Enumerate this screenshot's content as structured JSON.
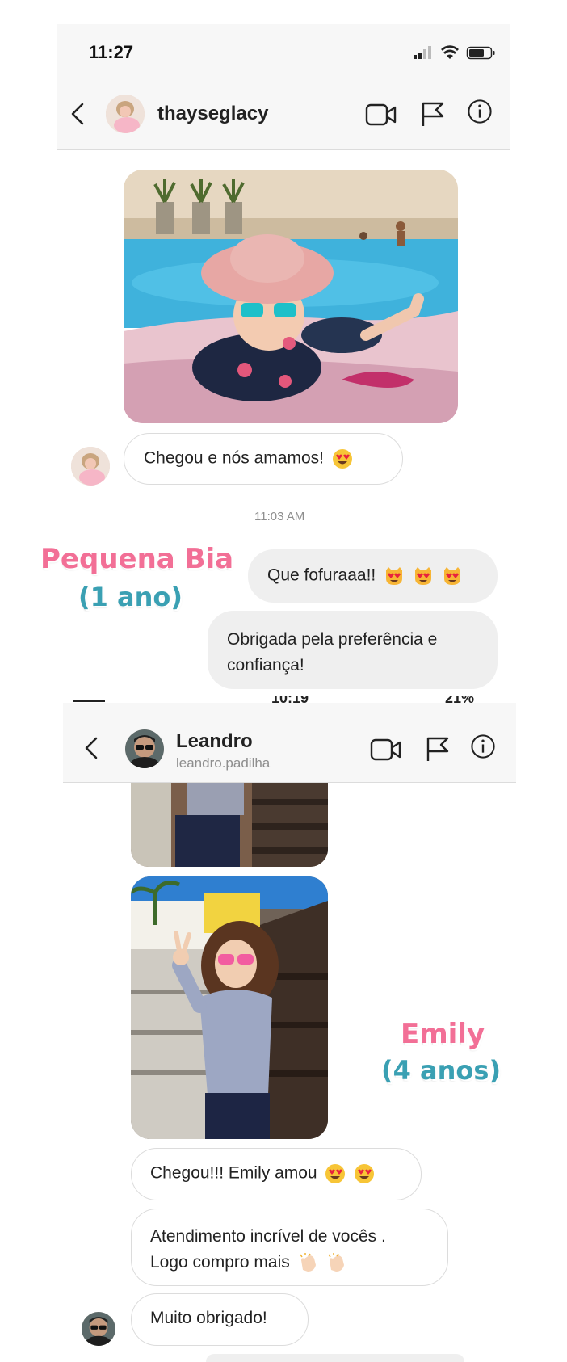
{
  "chat1": {
    "status_time": "11:27",
    "username": "thayseglacy",
    "message_1": "Chegou e nós amamos!",
    "timestamp": "11:03 AM",
    "reply_1": "Que fofuraaa!!",
    "reply_2_line1": "Obrigada pela preferência e",
    "reply_2_line2": "confiança!",
    "caption_name": "Pequena Bia",
    "caption_age": "(1 ano)"
  },
  "chat2": {
    "status_time": "10:19",
    "status_battery": "21%",
    "name": "Leandro",
    "handle": "leandro.padilha",
    "message_1": "Chegou!!! Emily amou",
    "message_2_line1": "Atendimento incrível de vocês .",
    "message_2_line2": "Logo compro mais",
    "message_3": "Muito obrigado!",
    "caption_name": "Emily",
    "caption_age": "(4 anos)"
  },
  "icons": {
    "back": "chevron-left-icon",
    "video": "video-camera-icon",
    "flag": "flag-icon",
    "info": "info-icon",
    "heart_eyes": "heart-eyes-emoji",
    "heart_eyes_cat": "heart-eyes-cat-emoji",
    "clapping": "clapping-hands-emoji"
  },
  "colors": {
    "caption_pink": "#f26f96",
    "caption_teal": "#3aa0b3",
    "incoming_bubble_border": "#dcdcdc",
    "outgoing_bubble": "#efefef"
  }
}
